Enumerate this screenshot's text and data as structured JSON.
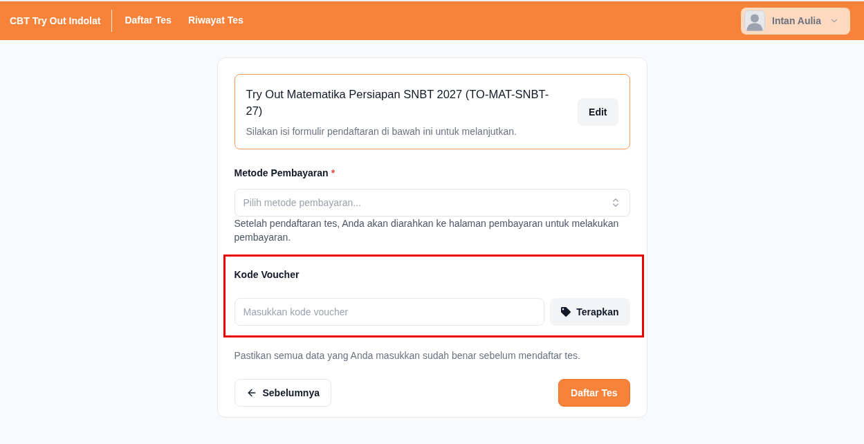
{
  "header": {
    "brand": "CBT Try Out Indolat",
    "nav": [
      {
        "label": "Daftar Tes",
        "selected": false
      },
      {
        "label": "Riwayat Tes",
        "selected": false
      }
    ],
    "user": {
      "name": "Intan Aulia"
    }
  },
  "test_card": {
    "title": "Try Out Matematika Persiapan SNBT 2027 (TO-MAT-SNBT-27)",
    "description": "Silakan isi formulir pendaftaran di bawah ini untuk melanjutkan.",
    "edit_button": "Edit"
  },
  "payment_method": {
    "label": "Metode Pembayaran",
    "required_mark": "*",
    "placeholder": "Pilih metode pembayaran...",
    "help": "Setelah pendaftaran tes, Anda akan diarahkan ke halaman pembayaran untuk melakukan pembayaran."
  },
  "voucher": {
    "label": "Kode Voucher",
    "placeholder": "Masukkan kode voucher",
    "apply_button": "Terapkan",
    "highlighted": true
  },
  "confirmation_note": "Pastikan semua data yang Anda masukkan sudah benar sebelum mendaftar tes.",
  "actions": {
    "back_button": "Sebelumnya",
    "submit_button": "Daftar Tes"
  }
}
